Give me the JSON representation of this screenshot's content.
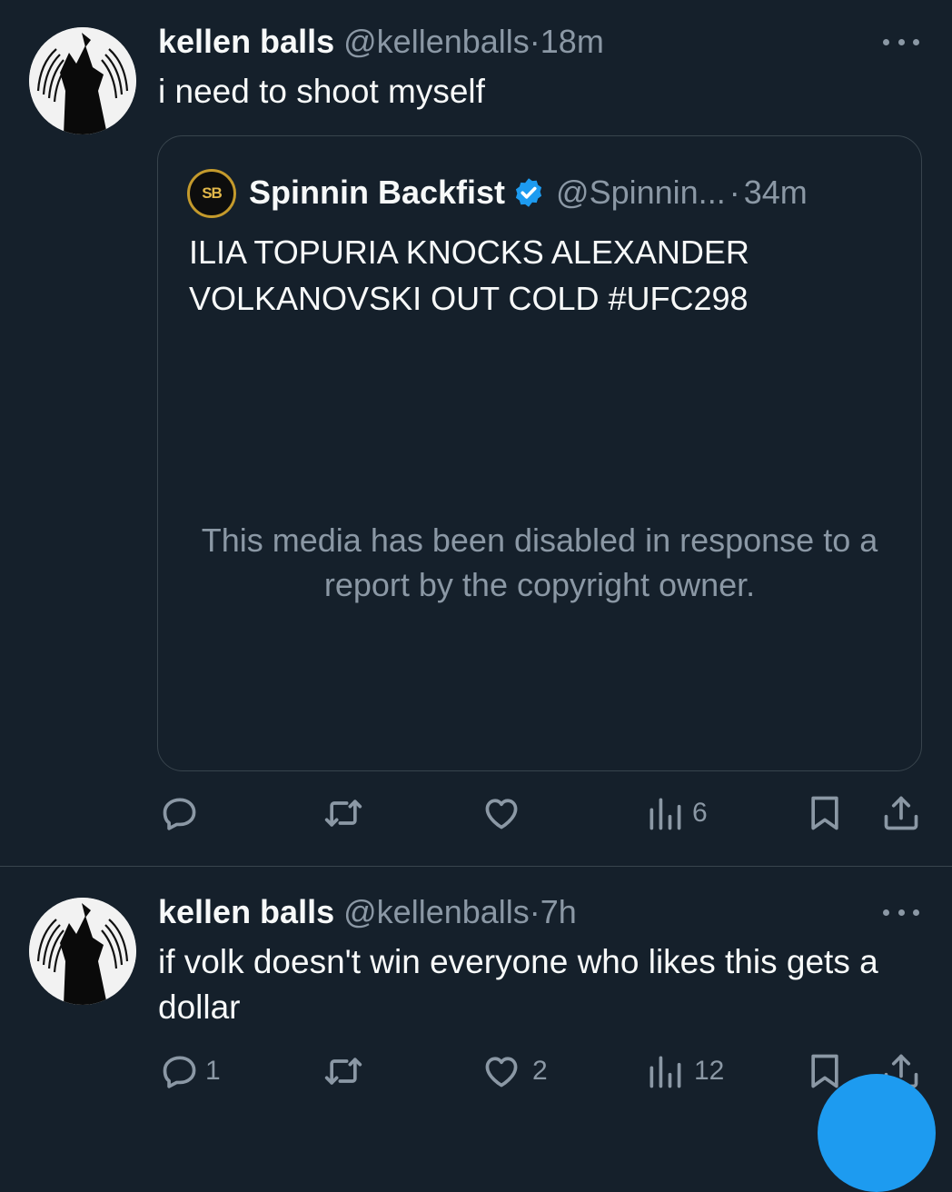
{
  "tweets": [
    {
      "name": "kellen balls",
      "handle": "@kellenballs",
      "sep": "·",
      "time": "18m",
      "text": "i need to shoot myself",
      "quote": {
        "avatar_text": "SB",
        "name": "Spinnin Backfist",
        "handle": "@Spinnin...",
        "sep": "·",
        "time": "34m",
        "text": "ILIA TOPURIA KNOCKS ALEXANDER VOLKANOVSKI OUT COLD #UFC298",
        "media_notice": "This media has been disabled in response to a report by the copyright owner."
      },
      "actions": {
        "reply_count": "",
        "retweet_count": "",
        "like_count": "",
        "views_count": "6"
      }
    },
    {
      "name": "kellen balls",
      "handle": "@kellenballs",
      "sep": "·",
      "time": "7h",
      "text": "if volk doesn't win everyone who likes this gets a dollar",
      "actions": {
        "reply_count": "1",
        "retweet_count": "",
        "like_count": "2",
        "views_count": "12"
      }
    }
  ],
  "colors": {
    "background": "#15202b",
    "secondary_text": "#8b98a5",
    "border": "#38444d",
    "verified": "#1d9bf0"
  },
  "icons": [
    "more-icon",
    "reply-icon",
    "retweet-icon",
    "like-icon",
    "views-icon",
    "bookmark-icon",
    "share-icon",
    "verified-badge-icon"
  ]
}
